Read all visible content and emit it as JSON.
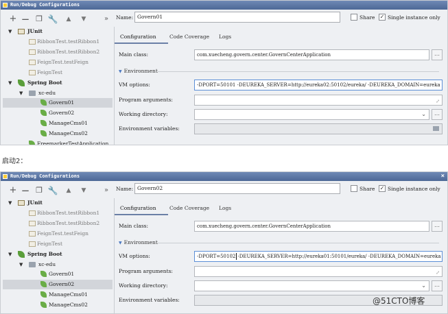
{
  "panels": [
    {
      "title": "Run/Debug Configurations",
      "toolbar": {
        "add": "+",
        "remove": "−",
        "copy": "❐",
        "edit": "🔧",
        "up": "▲",
        "down": "▼",
        "more": "»"
      },
      "tree": {
        "junit": {
          "label": "JUnit",
          "children": [
            "RibbonTest.testRibbon1",
            "RibbonTest.testRibbon2",
            "FeignTest.testFeign",
            "FeignTest"
          ]
        },
        "spring_boot": {
          "label": "Spring Boot",
          "group": "xc-edu",
          "children": [
            "Govern01",
            "Govern02",
            "ManageCms01",
            "ManageCms02"
          ],
          "extra": "FreemarkerTestApplication"
        },
        "selected": "Govern01"
      },
      "name_label": "Name:",
      "name_value": "Govern01",
      "share_label": "Share",
      "single_instance_label": "Single instance only",
      "tabs": [
        "Configuration",
        "Code Coverage",
        "Logs"
      ],
      "main_class_label": "Main class:",
      "main_class_value": "com.xuecheng.govern.center.GovernCenterApplication",
      "environment_label": "Environment",
      "vm_options_label": "VM options:",
      "vm_options_value_a": "-DPORT=50101 -DEUREKA_SERVER=http://eureka02:50102/eureka/ -DEUREKA_DOMAIN=eureka",
      "program_args_label": "Program arguments:",
      "working_dir_label": "Working directory:",
      "env_vars_label": "Environment variables:"
    },
    {
      "title": "Run/Debug Configurations",
      "toolbar": {
        "add": "+",
        "remove": "−",
        "copy": "❐",
        "edit": "🔧",
        "up": "▲",
        "down": "▼",
        "more": "»"
      },
      "tree": {
        "junit": {
          "label": "JUnit",
          "children": [
            "RibbonTest.testRibbon1",
            "RibbonTest.testRibbon2",
            "FeignTest.testFeign",
            "FeignTest"
          ]
        },
        "spring_boot": {
          "label": "Spring Boot",
          "group": "xc-edu",
          "children": [
            "Govern01",
            "Govern02",
            "ManageCms01",
            "ManageCms02"
          ]
        },
        "selected": "Govern02"
      },
      "name_label": "Name:",
      "name_value": "Govern02",
      "share_label": "Share",
      "single_instance_label": "Single instance only",
      "tabs": [
        "Configuration",
        "Code Coverage",
        "Logs"
      ],
      "main_class_label": "Main class:",
      "main_class_value": "com.xuecheng.govern.center.GovernCenterApplication",
      "environment_label": "Environment",
      "vm_options_label": "VM options:",
      "vm_options_value_a": "-DPORT=50102",
      "vm_options_value_b": "-DEUREKA_SERVER=http://eureka01:50101/eureka/ -DEUREKA_DOMAIN=eureka",
      "program_args_label": "Program arguments:",
      "working_dir_label": "Working directory:",
      "env_vars_label": "Environment variables:"
    }
  ],
  "caption": "启动2：",
  "watermark": "@51CTO博客"
}
